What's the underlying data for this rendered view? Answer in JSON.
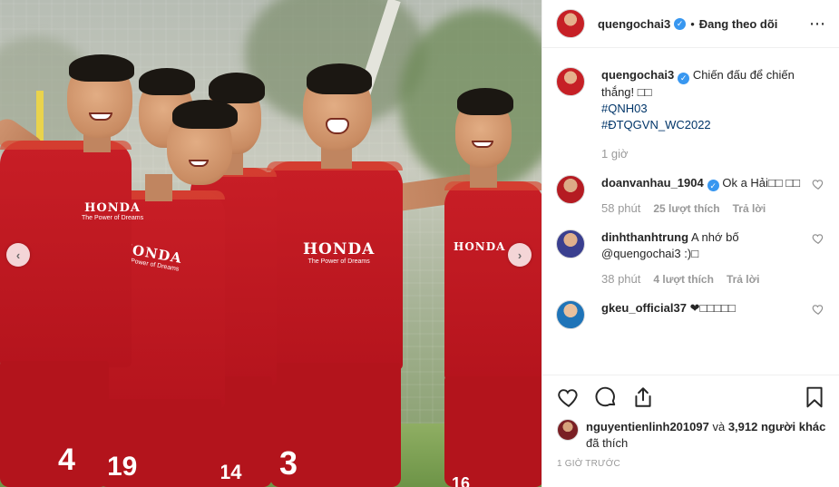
{
  "post": {
    "username": "quengochai3",
    "verified_mark": "✓",
    "follow_status": "Đang theo dõi",
    "more_icon": "⋯",
    "caption_text": "Chiến đấu để chiến thắng! □□",
    "hashtags": [
      "#QNH03",
      "#ĐTQGVN_WC2022"
    ],
    "caption_time": "1 giờ"
  },
  "photo": {
    "sponsor": "HONDA",
    "sponsor_tagline": "The Power of Dreams",
    "jersey_numbers": [
      "4",
      "19",
      "14",
      "3",
      "16"
    ],
    "prev_arrow": "‹",
    "next_arrow": "›"
  },
  "comments": [
    {
      "username": "doanvanhau_1904",
      "verified": true,
      "text": "Ok a Hải□□ □□",
      "time": "58 phút",
      "likes": "25 lượt thích",
      "reply": "Trả lời"
    },
    {
      "username": "dinhthanhtrung",
      "verified": false,
      "text": "A nhớ bố @quengochai3 :)□",
      "time": "38 phút",
      "likes": "4 lượt thích",
      "reply": "Trả lời"
    },
    {
      "username": "gkeu_official37",
      "verified": false,
      "text": "❤□□□□□",
      "time": "",
      "likes": "",
      "reply": ""
    }
  ],
  "actions": {
    "liked_by_user": "nguyentienlinh201097",
    "liked_conjunction": "và",
    "liked_count": "3,912 người khác",
    "liked_suffix": "đã thích",
    "time_ago": "1 GIỜ TRƯỚC"
  },
  "colors": {
    "verified": "#3897f0",
    "hashtag": "#003569",
    "muted": "#999999",
    "jersey_red": "#c81e26"
  }
}
